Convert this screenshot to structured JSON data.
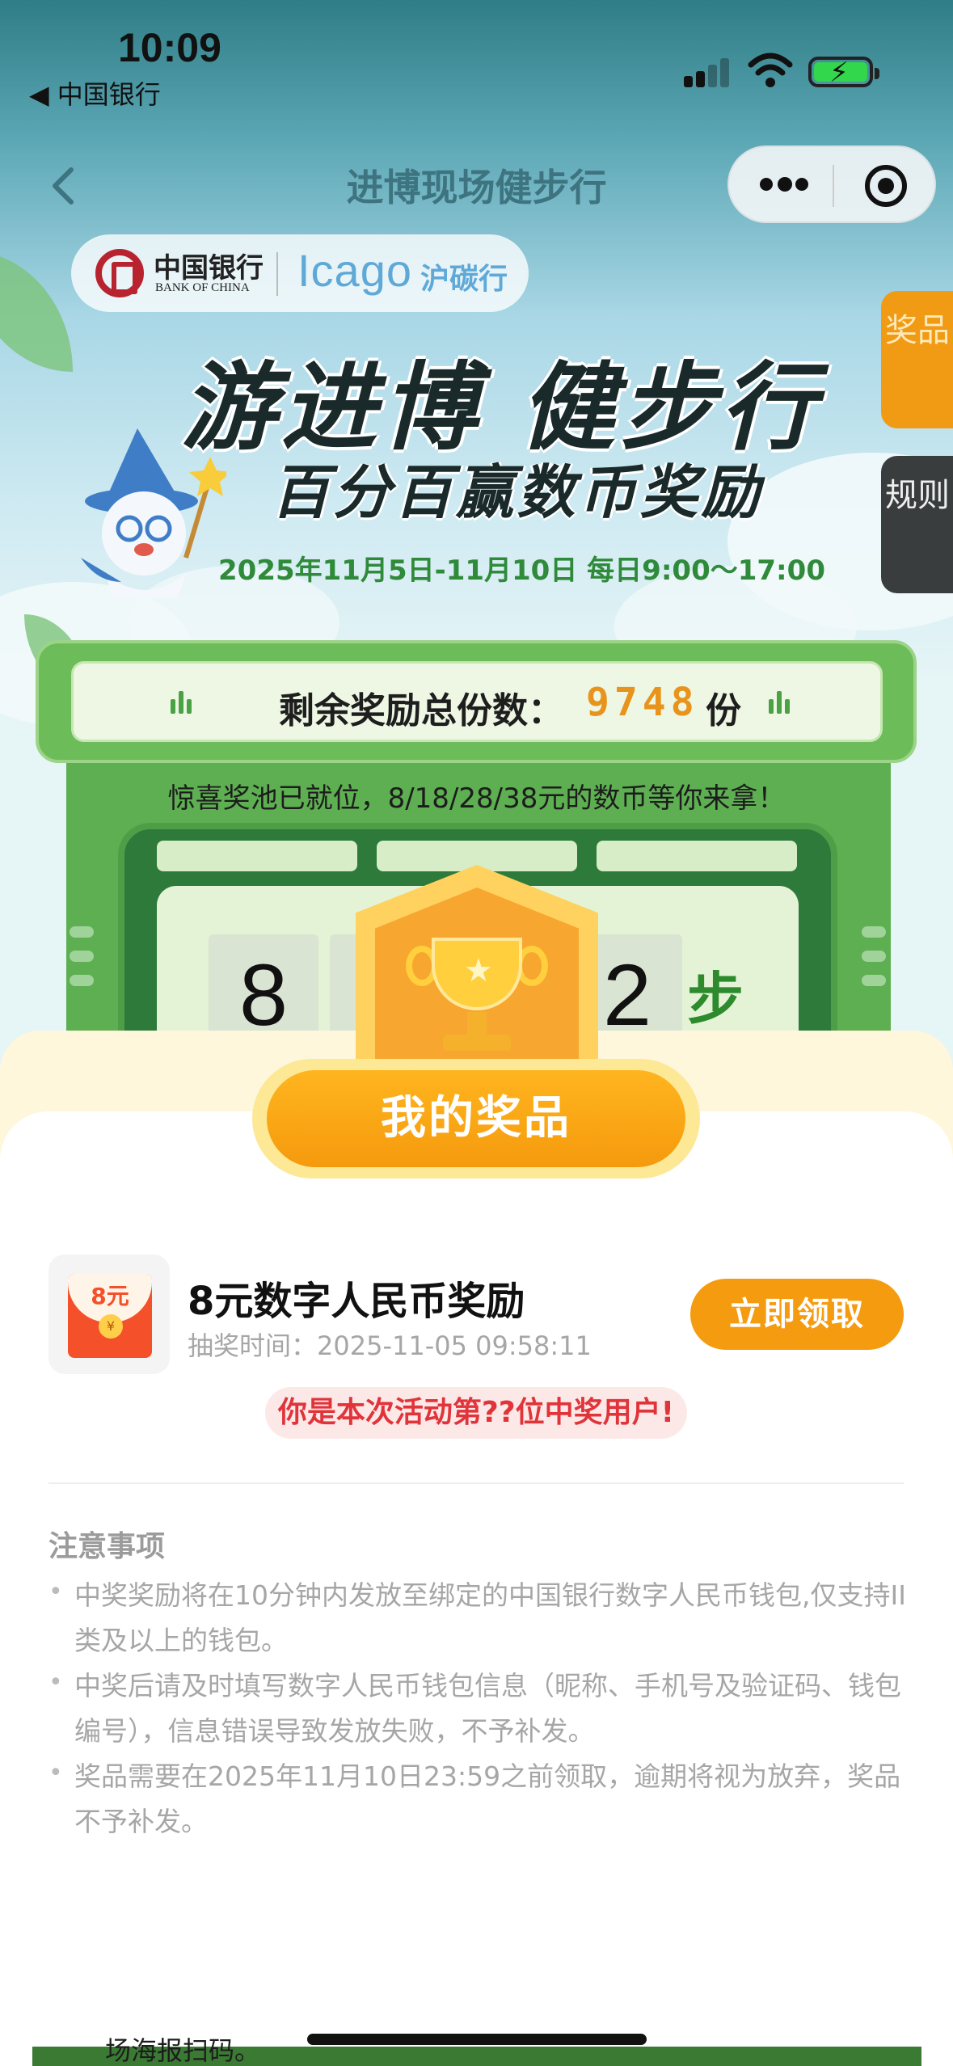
{
  "status_bar": {
    "time": "10:09",
    "back_app": "◀ 中国银行"
  },
  "nav": {
    "title": "进博现场健步行"
  },
  "logos": {
    "boc_cn": "中国银行",
    "boc_en": "BANK OF CHINA",
    "icago": "Icago",
    "hutan": "沪碳行"
  },
  "side_tabs": {
    "prizes": "奖品",
    "rules": "规则"
  },
  "banner": {
    "headline": "游进博 健步行",
    "subheadline": "百分百赢数币奖励",
    "date_range": "2025年11月5日-11月10日 每日9:00～17:00"
  },
  "remaining": {
    "label": "剩余奖励总份数：",
    "count": "9748",
    "unit": "份"
  },
  "pool_text": "惊喜奖池已就位，8/18/28/38元的数币等你来拿！",
  "steps": {
    "digits": [
      "8",
      "",
      "",
      "2"
    ],
    "unit": "步"
  },
  "sheet": {
    "title_button": "我的奖品",
    "prize": {
      "amount_badge": "8元",
      "coin_symbol": "¥",
      "name": "8元数字人民币奖励",
      "time": "抽奖时间：2025-11-05 09:58:11",
      "claim_button": "立即领取"
    },
    "winner_text": "你是本次活动第??位中奖用户!",
    "notes_title": "注意事项",
    "notes": [
      "中奖奖励将在10分钟内发放至绑定的中国银行数字人民币钱包,仅支持II类及以上的钱包。",
      "中奖后请及时填写数字人民币钱包信息（昵称、手机号及验证码、钱包编号），信息错误导致发放失败，不予补发。",
      "奖品需要在2025年11月10日23:59之前领取，逾期将视为放弃，奖品不予补发。"
    ]
  },
  "bottom_text": "场海报扫码。",
  "colors": {
    "accent_orange": "#f59b10",
    "brand_green": "#5eae52",
    "winner_red": "#e0343a"
  }
}
